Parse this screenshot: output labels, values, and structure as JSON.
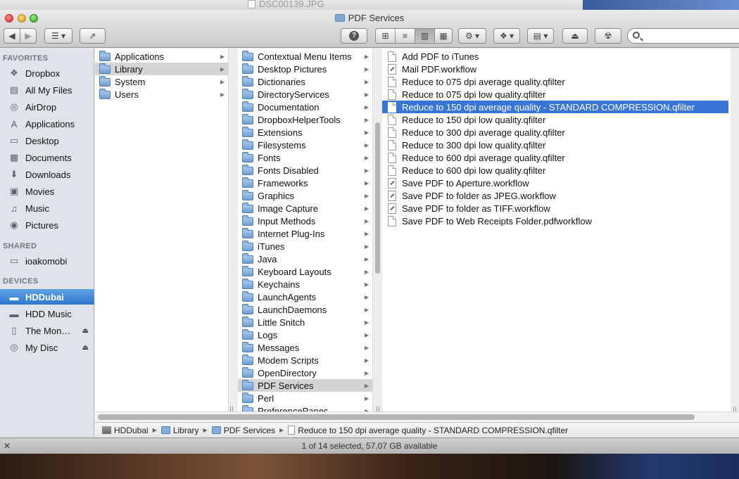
{
  "background": {
    "top_title": "DSC00139.JPG"
  },
  "window": {
    "title": "PDF Services"
  },
  "toolbar": {
    "back_icon": "back-arrow",
    "forward_icon": "forward-arrow",
    "arrange_icon": "list-menu",
    "share_icon": "share-arrow",
    "help_icon": "question-mark",
    "views": [
      "icon-view",
      "list-view",
      "column-view",
      "coverflow-view"
    ],
    "active_view": "column-view",
    "action_icon": "gear",
    "dropbox_icon": "dropbox",
    "arrange_grid_icon": "grid",
    "eject_icon": "eject",
    "burn_icon": "radiation"
  },
  "sidebar": {
    "favorites_header": "FAVORITES",
    "favorites": [
      {
        "label": "Dropbox",
        "icon": "dropbox"
      },
      {
        "label": "All My Files",
        "icon": "files"
      },
      {
        "label": "AirDrop",
        "icon": "airdrop"
      },
      {
        "label": "Applications",
        "icon": "applications"
      },
      {
        "label": "Desktop",
        "icon": "desktop"
      },
      {
        "label": "Documents",
        "icon": "documents"
      },
      {
        "label": "Downloads",
        "icon": "downloads"
      },
      {
        "label": "Movies",
        "icon": "movies"
      },
      {
        "label": "Music",
        "icon": "music"
      },
      {
        "label": "Pictures",
        "icon": "pictures"
      }
    ],
    "shared_header": "SHARED",
    "shared": [
      {
        "label": "ioakomobi",
        "icon": "computer"
      }
    ],
    "devices_header": "DEVICES",
    "devices": [
      {
        "label": "HDDubai",
        "icon": "hard-disk",
        "selected": true
      },
      {
        "label": "HDD Music",
        "icon": "hard-disk"
      },
      {
        "label": "The Mon…",
        "icon": "external-disk",
        "eject": true
      },
      {
        "label": "My Disc",
        "icon": "optical-disc",
        "eject": true
      }
    ]
  },
  "columns": {
    "col1": [
      "Applications",
      "Library",
      "System",
      "Users"
    ],
    "col1_selected": "Library",
    "col2": [
      "Contextual Menu Items",
      "Desktop Pictures",
      "Dictionaries",
      "DirectoryServices",
      "Documentation",
      "DropboxHelperTools",
      "Extensions",
      "Filesystems",
      "Fonts",
      "Fonts Disabled",
      "Frameworks",
      "Graphics",
      "Image Capture",
      "Input Methods",
      "Internet Plug-Ins",
      "iTunes",
      "Java",
      "Keyboard Layouts",
      "Keychains",
      "LaunchAgents",
      "LaunchDaemons",
      "Little Snitch",
      "Logs",
      "Messages",
      "Modem Scripts",
      "OpenDirectory",
      "PDF Services",
      "Perl",
      "PreferencePanes"
    ],
    "col2_selected": "PDF Services",
    "col3": [
      {
        "label": "Add PDF to iTunes",
        "kind": "app"
      },
      {
        "label": "Mail PDF.workflow",
        "kind": "workflow"
      },
      {
        "label": "Reduce to 075 dpi average quality.qfilter",
        "kind": "doc"
      },
      {
        "label": "Reduce to 075 dpi low quality.qfilter",
        "kind": "doc"
      },
      {
        "label": "Reduce to 150 dpi average quality - STANDARD COMPRESSION.qfilter",
        "kind": "doc"
      },
      {
        "label": "Reduce to 150 dpi low quality.qfilter",
        "kind": "doc"
      },
      {
        "label": "Reduce to 300 dpi average quality.qfilter",
        "kind": "doc"
      },
      {
        "label": "Reduce to 300 dpi low quality.qfilter",
        "kind": "doc"
      },
      {
        "label": "Reduce to 600 dpi average quality.qfilter",
        "kind": "doc"
      },
      {
        "label": "Reduce to 600 dpi low quality.qfilter",
        "kind": "doc"
      },
      {
        "label": "Save PDF to Aperture.workflow",
        "kind": "workflow"
      },
      {
        "label": "Save PDF to folder as JPEG.workflow",
        "kind": "workflow"
      },
      {
        "label": "Save PDF to folder as TIFF.workflow",
        "kind": "workflow"
      },
      {
        "label": "Save PDF to Web Receipts Folder.pdfworkflow",
        "kind": "doc"
      }
    ],
    "col3_selected_index": 4
  },
  "pathbar": {
    "crumbs": [
      "HDDubai",
      "Library",
      "PDF Services",
      "Reduce to 150 dpi average quality - STANDARD COMPRESSION.qfilter"
    ]
  },
  "status": {
    "text": "1 of 14 selected, 57.07 GB available"
  }
}
